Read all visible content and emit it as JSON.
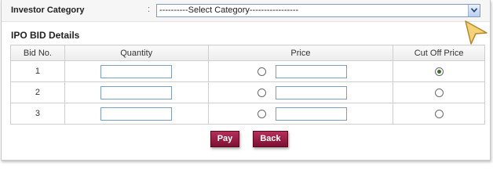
{
  "investor_category": {
    "label": "Investor Category",
    "colon": ":",
    "selected": "----------Select Category-----------------"
  },
  "section_title": "IPO BID Details",
  "table": {
    "headers": [
      "Bid No.",
      "Quantity",
      "Price",
      "Cut Off Price"
    ],
    "rows": [
      {
        "bid_no": "1",
        "quantity": "",
        "price": "",
        "price_selected": false,
        "cutoff_selected": true
      },
      {
        "bid_no": "2",
        "quantity": "",
        "price": "",
        "price_selected": false,
        "cutoff_selected": false
      },
      {
        "bid_no": "3",
        "quantity": "",
        "price": "",
        "price_selected": false,
        "cutoff_selected": false
      }
    ]
  },
  "buttons": {
    "pay": "Pay",
    "back": "Back"
  },
  "icons": {
    "dropdown": "chevron-down-icon",
    "cursor": "mouse-pointer-icon"
  },
  "colors": {
    "button": "#9b1c45",
    "select_border": "#7f9db9",
    "cursor_fill": "#f3d27a"
  }
}
